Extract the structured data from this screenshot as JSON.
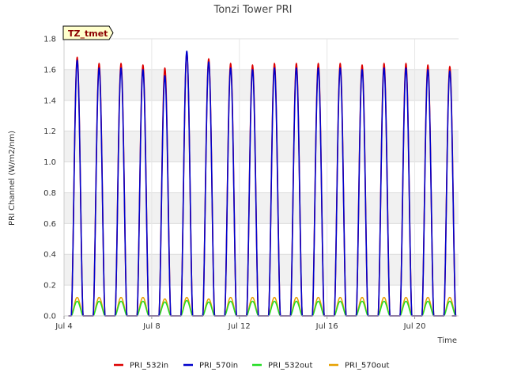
{
  "chart_data": {
    "type": "line",
    "title": "Tonzi Tower PRI",
    "xlabel": "Time",
    "ylabel": "PRI Channel (W/m2/nm)",
    "site_tag": "TZ_tmet",
    "ylim": [
      0,
      1.8
    ],
    "yticks": [
      "0.0",
      "0.2",
      "0.4",
      "0.6",
      "0.8",
      "1.0",
      "1.2",
      "1.4",
      "1.6",
      "1.8"
    ],
    "xlim": [
      "Jul 4",
      "Jul 22"
    ],
    "xticks": [
      {
        "label": "Jul 4",
        "day": 4
      },
      {
        "label": "Jul 8",
        "day": 8
      },
      {
        "label": "Jul 12",
        "day": 12
      },
      {
        "label": "Jul 16",
        "day": 16
      },
      {
        "label": "Jul 20",
        "day": 20
      }
    ],
    "grid": true,
    "legend_position": "bottom",
    "day_peak_dates": [
      "Jul 4",
      "Jul 5",
      "Jul 6",
      "Jul 7",
      "Jul 8",
      "Jul 9",
      "Jul 10",
      "Jul 11",
      "Jul 12",
      "Jul 13",
      "Jul 14",
      "Jul 15",
      "Jul 16",
      "Jul 17",
      "Jul 18",
      "Jul 19",
      "Jul 20",
      "Jul 21"
    ],
    "series": [
      {
        "name": "PRI_532in",
        "color": "#dd0000",
        "daily_peak": [
          1.68,
          1.64,
          1.64,
          1.63,
          1.61,
          1.71,
          1.67,
          1.64,
          1.63,
          1.64,
          1.64,
          1.64,
          1.64,
          1.63,
          1.64,
          1.64,
          1.63,
          1.62
        ]
      },
      {
        "name": "PRI_570in",
        "color": "#0000cc",
        "daily_peak": [
          1.66,
          1.61,
          1.61,
          1.6,
          1.56,
          1.72,
          1.65,
          1.61,
          1.6,
          1.61,
          1.61,
          1.61,
          1.61,
          1.6,
          1.61,
          1.61,
          1.6,
          1.59
        ]
      },
      {
        "name": "PRI_532out",
        "color": "#22dd22",
        "daily_peak": [
          0.095,
          0.095,
          0.095,
          0.095,
          0.09,
          0.1,
          0.09,
          0.095,
          0.095,
          0.095,
          0.095,
          0.095,
          0.095,
          0.095,
          0.095,
          0.095,
          0.095,
          0.095
        ]
      },
      {
        "name": "PRI_570out",
        "color": "#e6a000",
        "daily_peak": [
          0.12,
          0.12,
          0.12,
          0.12,
          0.11,
          0.12,
          0.11,
          0.12,
          0.12,
          0.12,
          0.12,
          0.12,
          0.12,
          0.12,
          0.12,
          0.12,
          0.12,
          0.12
        ]
      }
    ]
  }
}
